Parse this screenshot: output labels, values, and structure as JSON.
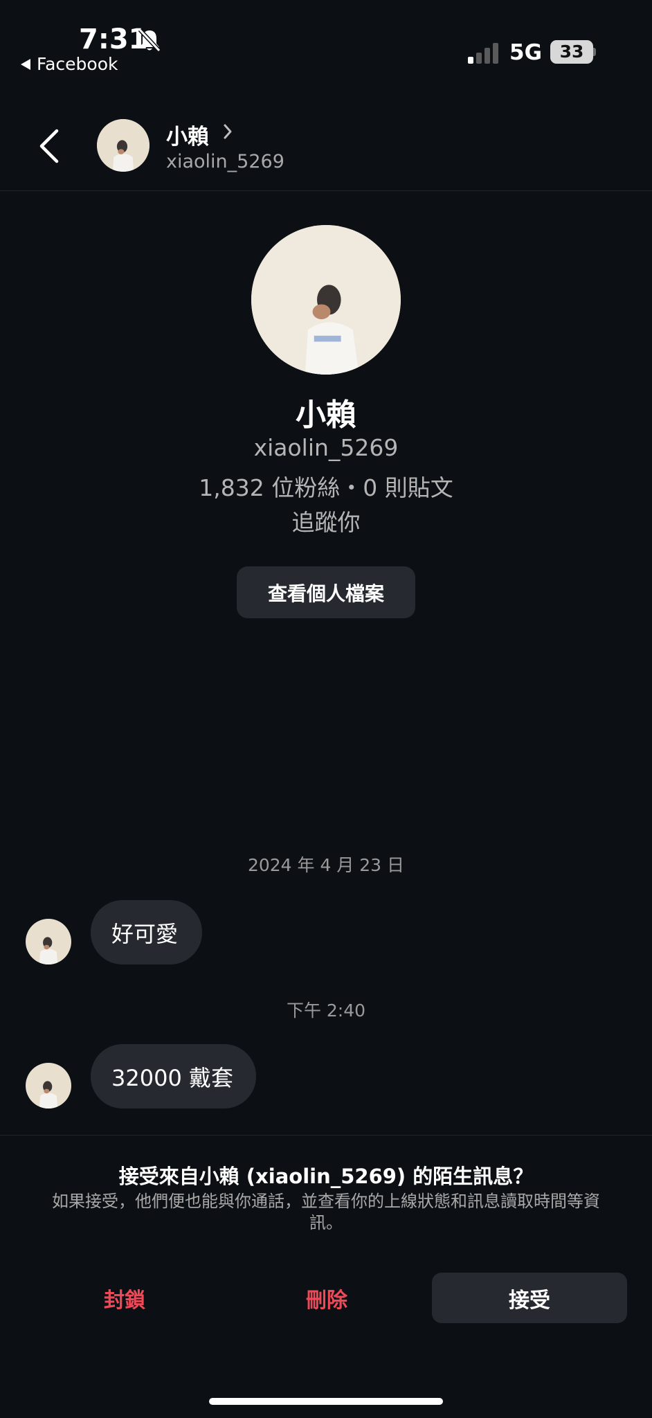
{
  "status_bar": {
    "time": "7:31",
    "back_app": "Facebook",
    "network": "5G",
    "battery": "33",
    "icons": [
      "bell-muted-icon",
      "signal-icon",
      "battery-icon"
    ]
  },
  "header": {
    "name": "小賴",
    "username": "xiaolin_5269",
    "icons": [
      "back-chevron-icon",
      "chevron-right-icon"
    ]
  },
  "profile": {
    "name": "小賴",
    "username": "xiaolin_5269",
    "stats": "1,832 位粉絲・0 則貼文",
    "follows_you": "追蹤你",
    "view_profile_label": "查看個人檔案"
  },
  "messages": [
    {
      "timestamp": "2024 年 4 月 23 日",
      "text": "好可愛"
    },
    {
      "timestamp": "下午 2:40",
      "text": "32000 戴套"
    }
  ],
  "request": {
    "title": "接受來自小賴 (xiaolin_5269) 的陌生訊息？",
    "description": "如果接受，他們便也能與你通話，並查看你的上線狀態和訊息讀取時間等資訊。",
    "block_label": "封鎖",
    "delete_label": "刪除",
    "accept_label": "接受"
  },
  "colors": {
    "background": "#0c1014",
    "bubble": "#262a30",
    "danger": "#ed4956",
    "secondary_text": "#a8a8a8"
  }
}
